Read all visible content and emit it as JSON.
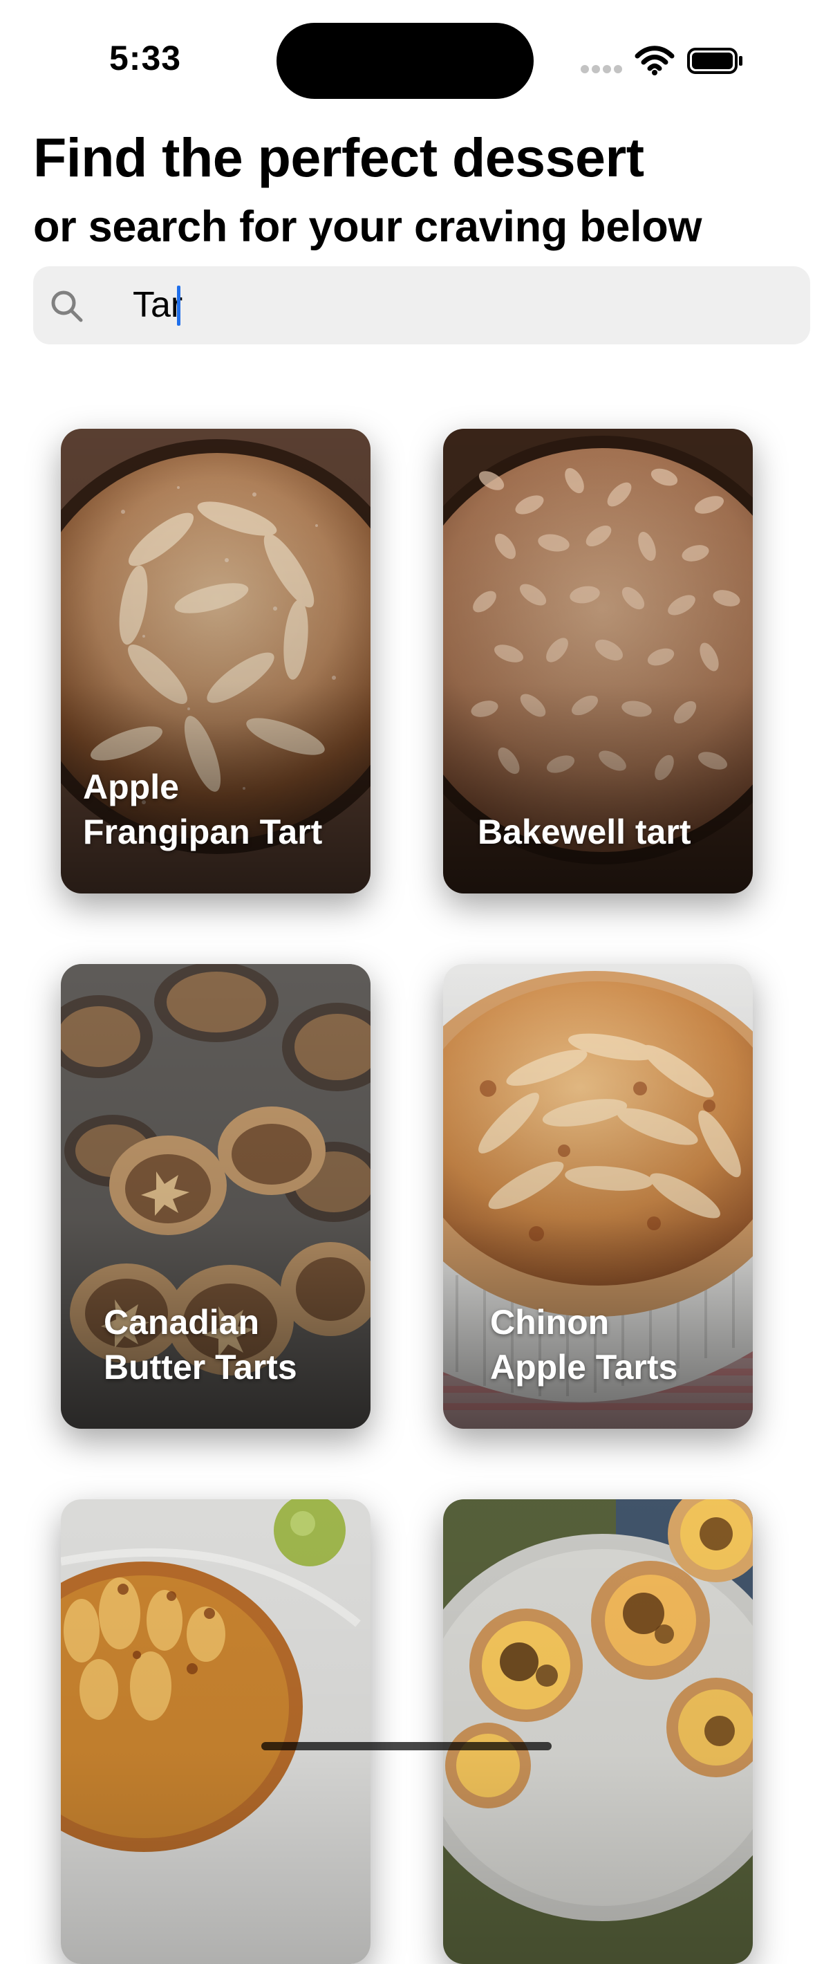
{
  "status_bar": {
    "time": "5:33"
  },
  "header": {
    "title": "Find the perfect dessert",
    "subtitle": "or search for your craving below"
  },
  "search": {
    "value": "Tar",
    "placeholder": ""
  },
  "desserts": [
    {
      "title": "Apple\nFrangipan Tart"
    },
    {
      "title": "Bakewell tart"
    },
    {
      "title": "Canadian\nButter Tarts"
    },
    {
      "title": "Chinon\nApple Tarts"
    },
    {
      "title": ""
    },
    {
      "title": ""
    }
  ],
  "colors": {
    "search_background": "#efefef",
    "caret": "#1f6feb",
    "text": "#000000"
  },
  "icons": {
    "search": "magnifying-glass-icon",
    "wifi": "wifi-icon",
    "battery": "battery-icon"
  }
}
